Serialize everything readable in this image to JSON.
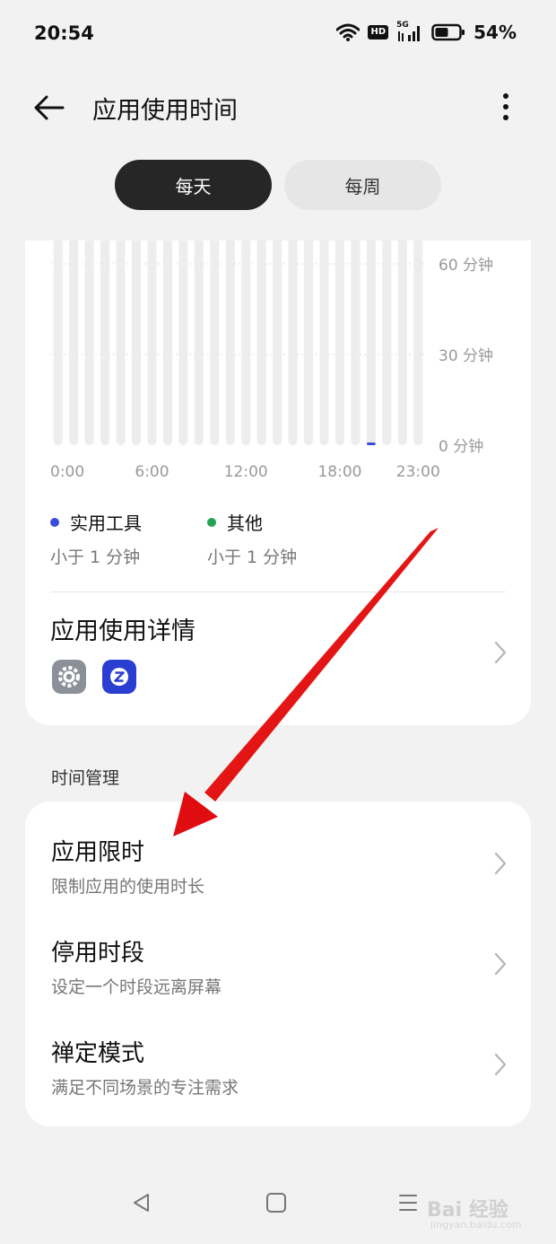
{
  "status_bar": {
    "time": "20:54",
    "hd": "HD",
    "network": "5G",
    "battery_percent": "54%",
    "battery_level": 0.54
  },
  "header": {
    "title": "应用使用时间",
    "back_icon": "arrow-left-icon",
    "more_icon": "more-vertical-icon"
  },
  "segments": {
    "day": "每天",
    "week": "每周",
    "selected": "day"
  },
  "chart_data": {
    "type": "bar",
    "x_ticks": [
      "0:00",
      "6:00",
      "12:00",
      "18:00",
      "23:00"
    ],
    "y_ticks": [
      "60 分钟",
      "30 分钟",
      "0 分钟"
    ],
    "ylim": [
      0,
      60
    ],
    "bar_count": 24,
    "series": [
      {
        "name": "实用工具",
        "color": "#3b4cd8",
        "values": [
          0,
          0,
          0,
          0,
          0,
          0,
          0,
          0,
          0,
          0,
          0,
          0,
          0,
          0,
          0,
          0,
          0,
          0,
          0,
          0,
          0.3,
          0,
          0,
          0
        ]
      },
      {
        "name": "其他",
        "color": "#23a455",
        "values": [
          0,
          0,
          0,
          0,
          0,
          0,
          0,
          0,
          0,
          0,
          0,
          0,
          0,
          0,
          0,
          0,
          0,
          0,
          0,
          0,
          0,
          0,
          0,
          0
        ]
      }
    ],
    "grid": true
  },
  "legend": [
    {
      "label": "实用工具",
      "value": "小于 1 分钟",
      "color": "#3b4cd8"
    },
    {
      "label": "其他",
      "value": "小于 1 分钟",
      "color": "#23a455"
    }
  ],
  "details": {
    "title": "应用使用详情",
    "apps": [
      "settings-app-icon",
      "z-app-icon"
    ]
  },
  "time_management": {
    "section_label": "时间管理",
    "items": [
      {
        "title": "应用限时",
        "subtitle": "限制应用的使用时长"
      },
      {
        "title": "停用时段",
        "subtitle": "设定一个时段远离屏幕"
      },
      {
        "title": "禅定模式",
        "subtitle": "满足不同场景的专注需求"
      }
    ]
  },
  "nav": {
    "back_icon": "triangle-back-icon",
    "home_icon": "square-home-icon",
    "menu_icon": "menu-lines-icon"
  },
  "watermark": {
    "brand": "Bai 经验",
    "url": "jingyan.baidu.com"
  },
  "colors": {
    "background": "#f2f2f2",
    "card": "#ffffff",
    "selected_segment": "#262626",
    "arrow": "#e8101a"
  }
}
